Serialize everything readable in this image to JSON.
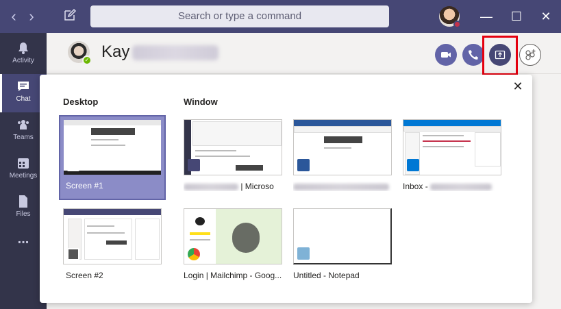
{
  "titlebar": {
    "search_placeholder": "Search or type a command",
    "back_icon": "chevron-left-icon",
    "forward_icon": "chevron-right-icon",
    "compose_icon": "compose-icon",
    "minimize_glyph": "—",
    "maximize_glyph": "☐",
    "close_glyph": "✕"
  },
  "rail": {
    "items": [
      {
        "label": "Activity",
        "icon": "bell-icon"
      },
      {
        "label": "Chat",
        "icon": "chat-icon",
        "active": true
      },
      {
        "label": "Teams",
        "icon": "teams-icon"
      },
      {
        "label": "Meetings",
        "icon": "calendar-icon"
      },
      {
        "label": "Files",
        "icon": "file-icon"
      },
      {
        "label": "...",
        "icon": "more-icon"
      }
    ]
  },
  "header": {
    "person_first_name": "Kay"
  },
  "share_tray": {
    "close_glyph": "✕",
    "desktop_title": "Desktop",
    "window_title": "Window",
    "desktop_items": [
      {
        "caption": "Screen #1",
        "selected": true
      },
      {
        "caption": "Screen #2",
        "selected": false
      }
    ],
    "window_items": [
      {
        "caption": "| Microso",
        "app": "teams"
      },
      {
        "caption": "",
        "app": "word"
      },
      {
        "caption": "Inbox -",
        "app": "outlook"
      },
      {
        "caption": "Login | Mailchimp - Goog...",
        "app": "chrome"
      },
      {
        "caption": "Untitled - Notepad",
        "app": "notepad"
      }
    ]
  },
  "colors": {
    "title_bar": "#464775",
    "rail": "#33344a",
    "accent": "#6264a7",
    "highlight_box": "#e4000f",
    "presence_available": "#6bb700"
  }
}
